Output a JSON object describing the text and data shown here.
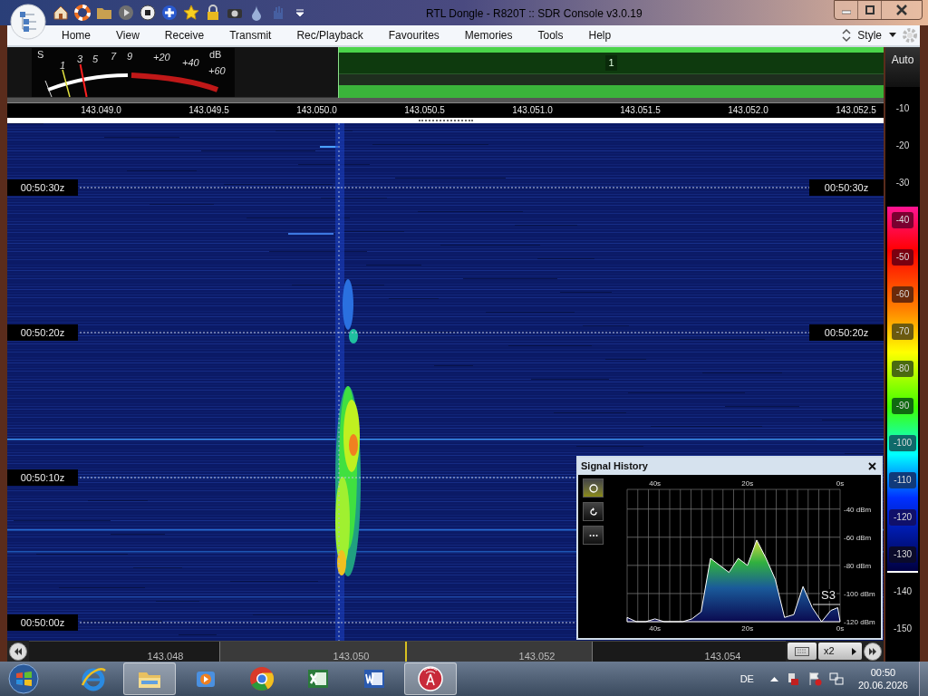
{
  "window": {
    "title": "RTL Dongle - R820T :: SDR Console v3.0.19"
  },
  "menu": [
    {
      "label": "Home"
    },
    {
      "label": "View"
    },
    {
      "label": "Receive"
    },
    {
      "label": "Transmit"
    },
    {
      "label": "Rec/Playback"
    },
    {
      "label": "Favourites"
    },
    {
      "label": "Memories"
    },
    {
      "label": "Tools"
    },
    {
      "label": "Help"
    }
  ],
  "style_menu": {
    "label": "Style"
  },
  "smeter": {
    "s_label": "S",
    "db_label": "dB",
    "scale": [
      "1",
      "3",
      "5",
      "7",
      "9",
      "+20",
      "+40",
      "+60"
    ],
    "level": 0.24
  },
  "spectrum": {
    "channel_label": "1"
  },
  "auto_button": {
    "label": "Auto"
  },
  "frequency_ruler": [
    "143.049.0",
    "143.049.5",
    "143.050.0",
    "143.050.5",
    "143.051.0",
    "143.051.5",
    "143.052.0",
    "143.052.5"
  ],
  "waterfall": {
    "time_labels_left": [
      "00:50:30z",
      "00:50:20z",
      "00:50:10z",
      "00:50:00z"
    ],
    "time_labels_right": [
      "00:50:30z",
      "00:50:20z"
    ]
  },
  "color_scale": [
    {
      "label": "-10",
      "kind": "plain"
    },
    {
      "label": "-20",
      "kind": "plain"
    },
    {
      "label": "-30",
      "kind": "plain"
    },
    {
      "label": "-40",
      "kind": "badge",
      "color": "#7a0030"
    },
    {
      "label": "-50",
      "kind": "badge",
      "color": "#7a0010"
    },
    {
      "label": "-60",
      "kind": "badge",
      "color": "#6b2a0a"
    },
    {
      "label": "-70",
      "kind": "badge",
      "color": "#6b5a10"
    },
    {
      "label": "-80",
      "kind": "badge",
      "color": "#4a6a10"
    },
    {
      "label": "-90",
      "kind": "badge",
      "color": "#106a10"
    },
    {
      "label": "-100",
      "kind": "badge",
      "color": "#0f6a6a"
    },
    {
      "label": "-110",
      "kind": "badge",
      "color": "#103a7a"
    },
    {
      "label": "-120",
      "kind": "badge",
      "color": "#10106a"
    },
    {
      "label": "-130",
      "kind": "badge",
      "color": "#0a0a2a"
    },
    {
      "label": "-140",
      "kind": "plain"
    },
    {
      "label": "-150",
      "kind": "plain"
    }
  ],
  "signal_history": {
    "title": "Signal History",
    "s_reading": "S3",
    "chart_data": {
      "type": "area",
      "x": [
        46,
        44,
        42,
        40,
        38,
        36,
        34,
        32,
        30,
        28,
        26,
        24,
        22,
        20,
        18,
        16,
        14,
        12,
        10,
        8,
        6,
        4,
        2,
        0.5,
        0
      ],
      "series": [
        {
          "color": "#ffffff",
          "values": [
            -117,
            -120,
            -120,
            -118,
            -120,
            -120,
            -120,
            -118,
            -113,
            -75,
            -80,
            -85,
            -75,
            -80,
            -62,
            -75,
            -90,
            -117,
            -115,
            -95,
            -110,
            -120,
            -112,
            -110,
            -120
          ]
        }
      ],
      "xlim": [
        46,
        0
      ],
      "ylim": [
        -120,
        -26
      ],
      "grid": true,
      "xticks": [
        {
          "value": 40,
          "label": "40s"
        },
        {
          "value": 20,
          "label": "20s"
        },
        {
          "value": 0,
          "label": "0s"
        }
      ],
      "yticks": [
        {
          "value": -40,
          "label": "-40 dBm"
        },
        {
          "value": -60,
          "label": "-60 dBm"
        },
        {
          "value": -80,
          "label": "-80 dBm"
        },
        {
          "value": -100,
          "label": "-100 dBm"
        },
        {
          "value": -120,
          "label": "-120 dBm"
        }
      ]
    }
  },
  "band_scroll": {
    "labels": [
      "143.048",
      "143.050",
      "143.052",
      "143.054"
    ],
    "zoom": "x2"
  },
  "taskbar": {
    "apps": [
      {
        "kind": "ie",
        "selected": false
      },
      {
        "kind": "explorer",
        "selected": true
      },
      {
        "kind": "media",
        "selected": false
      },
      {
        "kind": "chrome",
        "selected": false
      },
      {
        "kind": "excel",
        "selected": false
      },
      {
        "kind": "word",
        "selected": false
      },
      {
        "kind": "sdr",
        "selected": true
      }
    ],
    "language": "DE",
    "time": "00:50",
    "date": "20.06.2026"
  }
}
